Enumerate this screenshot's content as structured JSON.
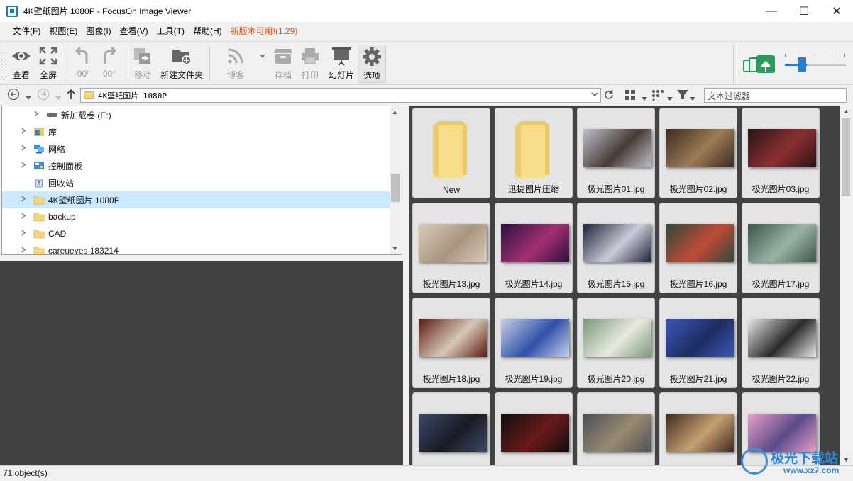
{
  "window": {
    "title": "4K壁纸图片 1080P - FocusOn Image Viewer",
    "minimize": "—",
    "maximize": "☐",
    "close": "✕"
  },
  "menu": {
    "items": [
      "文件(F)",
      "视图(E)",
      "图像(I)",
      "查看(V)",
      "工具(T)",
      "帮助(H)"
    ],
    "update": "新版本可用!(1.29)"
  },
  "toolbar": {
    "view": "查看",
    "fullscreen": "全屏",
    "rotate_left": "-90°",
    "rotate_right": "90°",
    "move": "移动",
    "new_folder": "新建文件夹",
    "blog": "博客",
    "archive": "存档",
    "print": "打印",
    "slideshow": "幻灯片",
    "options": "选项",
    "zoom_level": 0.3
  },
  "address": {
    "path": "4K壁纸图片  1080P",
    "filter_placeholder": "文本过滤器"
  },
  "tree": {
    "items": [
      {
        "label": "新加载卷 (E:)",
        "icon": "drive-icon",
        "indent": 2,
        "expandable": true
      },
      {
        "label": "库",
        "icon": "library-icon",
        "indent": 1,
        "expandable": true
      },
      {
        "label": "网络",
        "icon": "network-icon",
        "indent": 1,
        "expandable": true
      },
      {
        "label": "控制面板",
        "icon": "control-panel-icon",
        "indent": 1,
        "expandable": true
      },
      {
        "label": "回收站",
        "icon": "recycle-bin-icon",
        "indent": 1,
        "expandable": false
      },
      {
        "label": "4K壁纸图片 1080P",
        "icon": "folder-icon",
        "indent": 1,
        "expandable": true,
        "selected": true
      },
      {
        "label": "backup",
        "icon": "folder-icon",
        "indent": 1,
        "expandable": true
      },
      {
        "label": "CAD",
        "icon": "folder-icon",
        "indent": 1,
        "expandable": true
      },
      {
        "label": "careueyes 183214",
        "icon": "folder-icon",
        "indent": 1,
        "expandable": true
      }
    ]
  },
  "grid": {
    "items": [
      {
        "name": "New",
        "kind": "folder"
      },
      {
        "name": "迅捷图片压缩",
        "kind": "folder"
      },
      {
        "name": "极光图片01.jpg",
        "kind": "image",
        "colors": [
          "#b9c3cc",
          "#4a3a36"
        ]
      },
      {
        "name": "极光图片02.jpg",
        "kind": "image",
        "colors": [
          "#3b2b22",
          "#9b7b55"
        ]
      },
      {
        "name": "极光图片03.jpg",
        "kind": "image",
        "colors": [
          "#2a1418",
          "#8a3030"
        ]
      },
      {
        "name": "极光图片13.jpg",
        "kind": "image",
        "colors": [
          "#d8cbb9",
          "#a99580"
        ]
      },
      {
        "name": "极光图片14.jpg",
        "kind": "image",
        "colors": [
          "#2c1040",
          "#a23070"
        ]
      },
      {
        "name": "极光图片15.jpg",
        "kind": "image",
        "colors": [
          "#1c2238",
          "#c9cbd8"
        ]
      },
      {
        "name": "极光图片16.jpg",
        "kind": "image",
        "colors": [
          "#2d4a38",
          "#c04a3a"
        ]
      },
      {
        "name": "极光图片17.jpg",
        "kind": "image",
        "colors": [
          "#3a5448",
          "#9ab4a4"
        ]
      },
      {
        "name": "极光图片18.jpg",
        "kind": "image",
        "colors": [
          "#5a1a12",
          "#d8c8b8"
        ]
      },
      {
        "name": "极光图片19.jpg",
        "kind": "image",
        "colors": [
          "#c8d0e8",
          "#3050a8"
        ]
      },
      {
        "name": "极光图片20.jpg",
        "kind": "image",
        "colors": [
          "#7a9a78",
          "#e8e8e0"
        ]
      },
      {
        "name": "极光图片21.jpg",
        "kind": "image",
        "colors": [
          "#3a58b8",
          "#1e2c60"
        ]
      },
      {
        "name": "极光图片22.jpg",
        "kind": "image",
        "colors": [
          "#e8e8e8",
          "#2a2a2a"
        ]
      },
      {
        "name": "",
        "kind": "image",
        "colors": [
          "#3a4a68",
          "#1a1a24"
        ]
      },
      {
        "name": "",
        "kind": "image",
        "colors": [
          "#0e0e0e",
          "#6a1a1a"
        ]
      },
      {
        "name": "",
        "kind": "image",
        "colors": [
          "#4a5058",
          "#9a8a70"
        ]
      },
      {
        "name": "",
        "kind": "image",
        "colors": [
          "#3a2a20",
          "#c8a070"
        ]
      },
      {
        "name": "",
        "kind": "image",
        "colors": [
          "#e8a0c8",
          "#5a4a8a"
        ]
      }
    ]
  },
  "status": {
    "count": "71 object(s)"
  },
  "watermark": {
    "text": "极光下载站",
    "url": "www.xz7.com"
  }
}
